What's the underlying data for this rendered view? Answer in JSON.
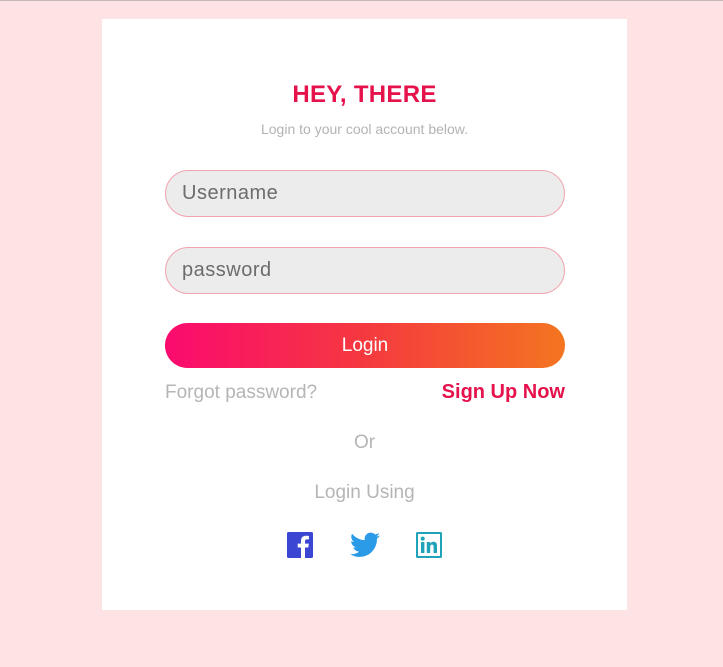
{
  "login_form": {
    "title": "HEY, THERE",
    "subtitle": "Login to your cool account below.",
    "username_placeholder": "Username",
    "password_placeholder": "password",
    "login_label": "Login",
    "forgot_label": "Forgot password?",
    "signup_label": "Sign Up Now",
    "or_label": "Or",
    "login_using_label": "Login Using"
  },
  "social": {
    "icons": [
      "facebook-icon",
      "twitter-icon",
      "linkedin-icon"
    ]
  },
  "colors": {
    "background": "#fde3e3",
    "accent": "#e5124c",
    "facebook": "#3b47d2",
    "twitter": "#2b9be8",
    "linkedin": "#1fa3b8",
    "gradient_start": "#fb0a6f",
    "gradient_end": "#f47520"
  }
}
